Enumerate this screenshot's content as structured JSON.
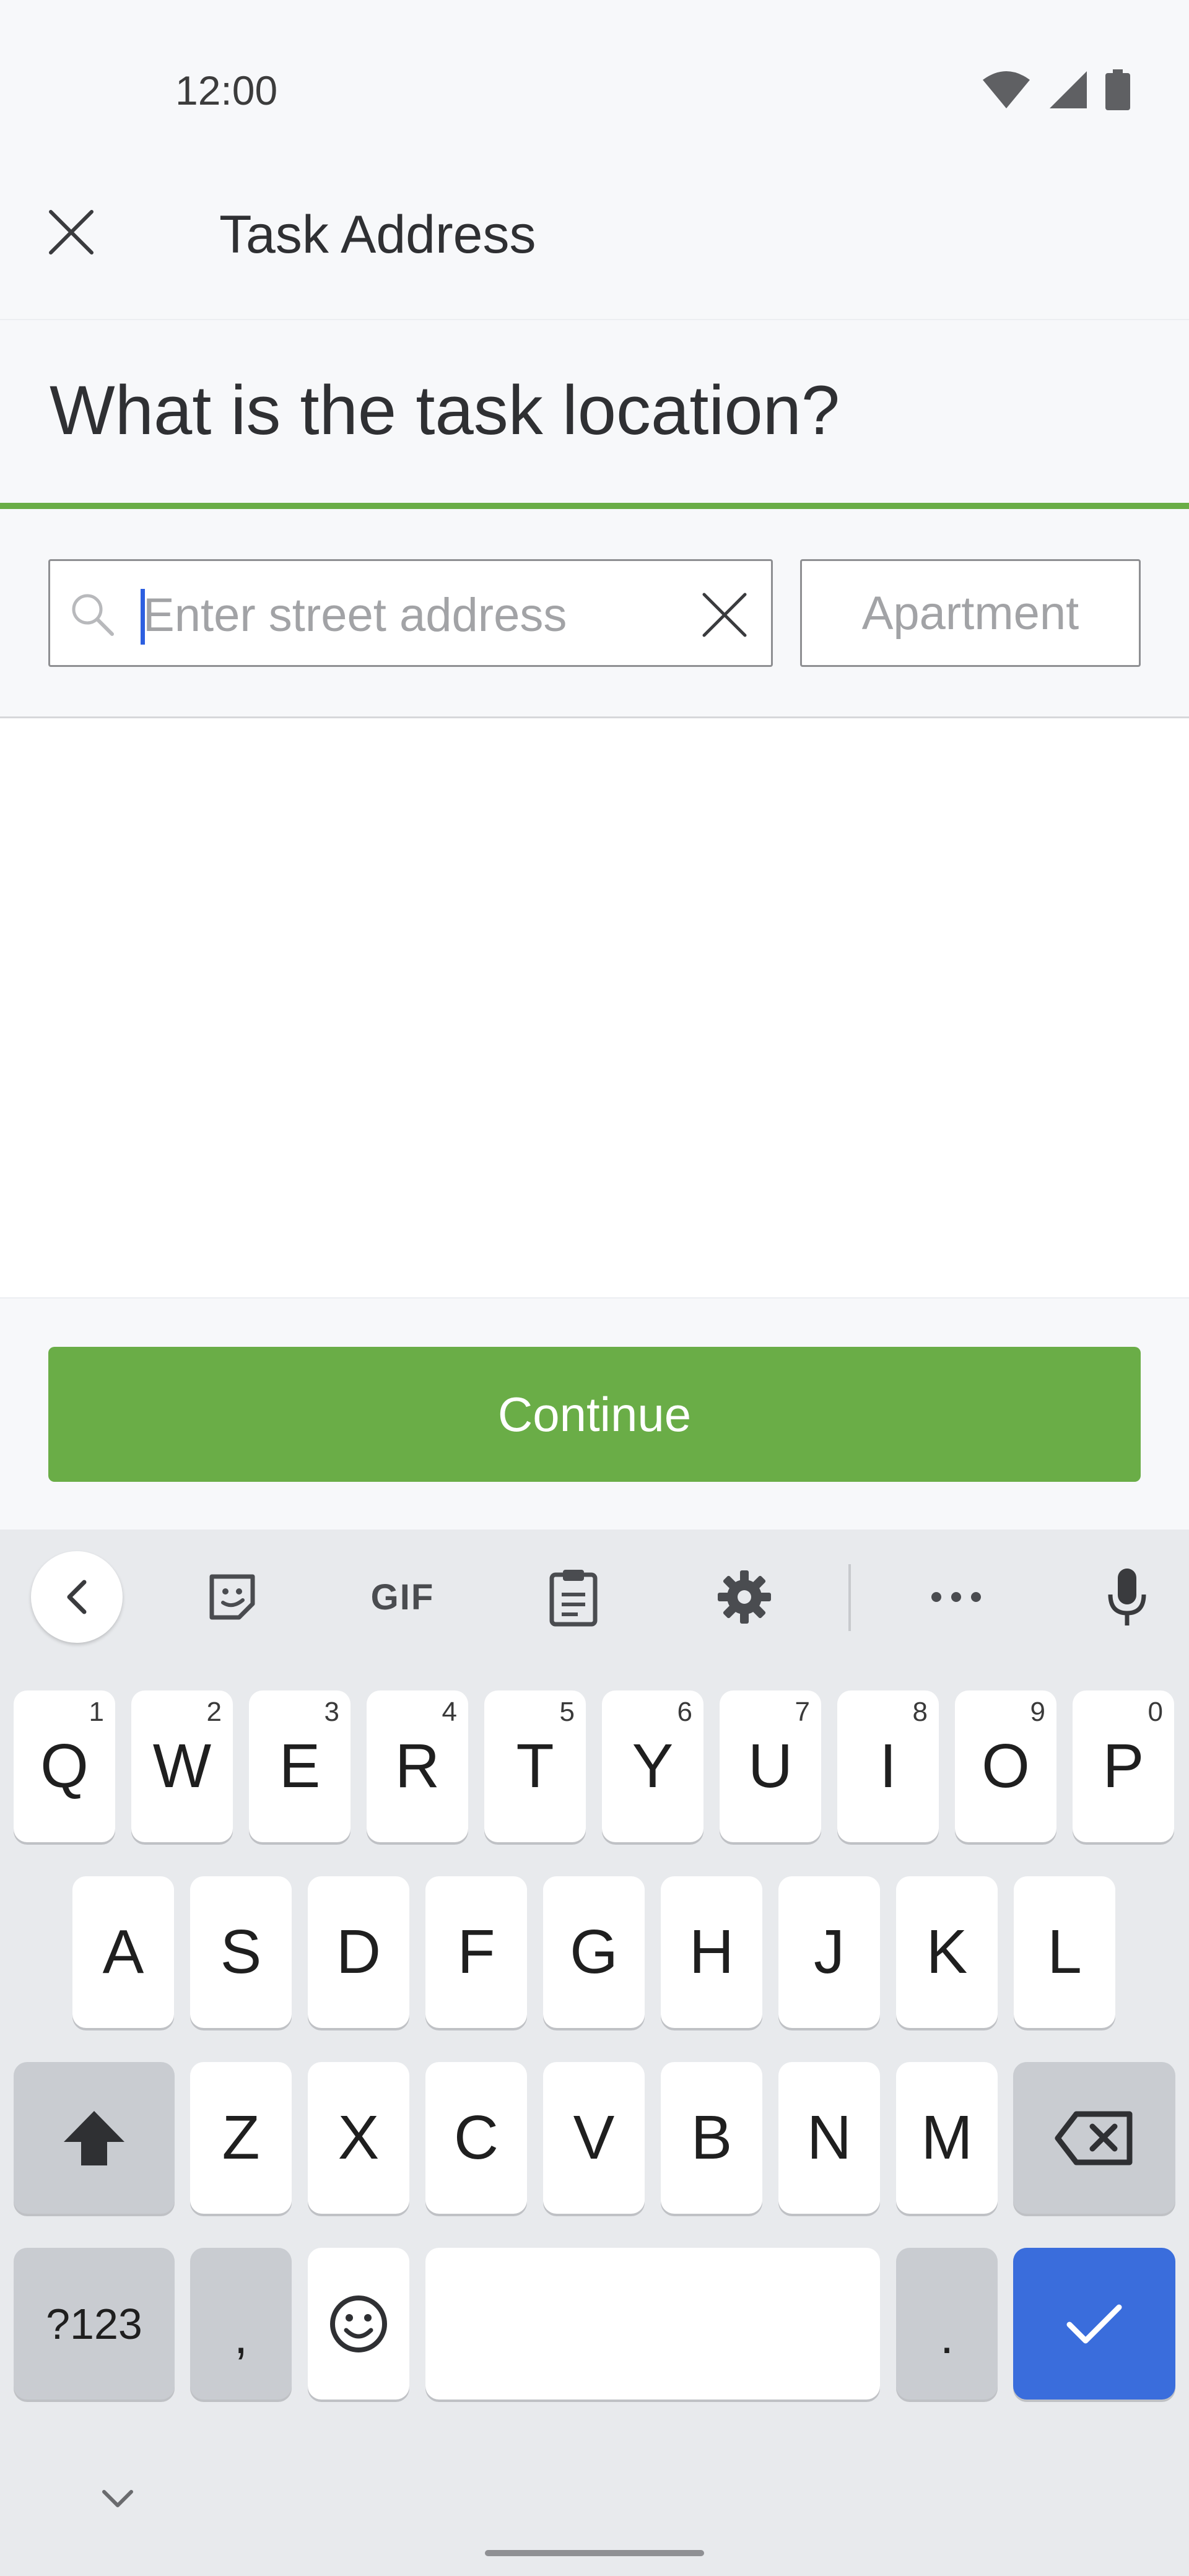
{
  "status": {
    "time": "12:00",
    "icons": [
      "wifi-icon",
      "signal-icon",
      "battery-icon"
    ]
  },
  "app_bar": {
    "close_icon": "close-icon",
    "title": "Task Address"
  },
  "question": "What is the task location?",
  "form": {
    "street": {
      "value": "",
      "placeholder": "Enter street address"
    },
    "apartment": {
      "value": "",
      "placeholder": "Apartment"
    }
  },
  "continue_label": "Continue",
  "keyboard": {
    "toolbar": {
      "gif": "GIF",
      "icons": [
        "chevron-left-icon",
        "sticker-icon",
        "gif-icon",
        "clipboard-icon",
        "gear-icon",
        "more-icon",
        "mic-icon"
      ]
    },
    "row1": [
      {
        "label": "Q",
        "hint": "1"
      },
      {
        "label": "W",
        "hint": "2"
      },
      {
        "label": "E",
        "hint": "3"
      },
      {
        "label": "R",
        "hint": "4"
      },
      {
        "label": "T",
        "hint": "5"
      },
      {
        "label": "Y",
        "hint": "6"
      },
      {
        "label": "U",
        "hint": "7"
      },
      {
        "label": "I",
        "hint": "8"
      },
      {
        "label": "O",
        "hint": "9"
      },
      {
        "label": "P",
        "hint": "0"
      }
    ],
    "row2": [
      "A",
      "S",
      "D",
      "F",
      "G",
      "H",
      "J",
      "K",
      "L"
    ],
    "row3": [
      "Z",
      "X",
      "C",
      "V",
      "B",
      "N",
      "M"
    ],
    "symbols": "?123",
    "comma": ",",
    "period": ".",
    "colors": {
      "accent_green": "#6aad47",
      "keyboard_blue": "#3a6ddc"
    }
  }
}
